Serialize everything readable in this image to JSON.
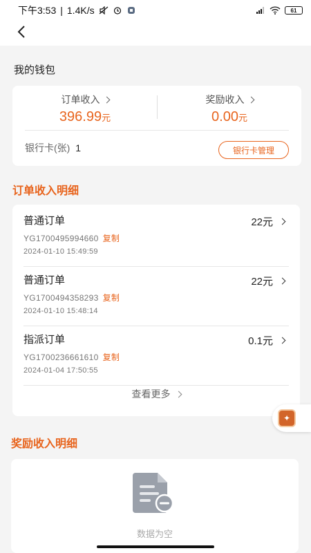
{
  "status_bar": {
    "time": "下午3:53",
    "net_speed": "1.4K/s",
    "battery": "61"
  },
  "wallet": {
    "title": "我的钱包",
    "order_income": {
      "label": "订单收入",
      "value": "396.99",
      "unit": "元"
    },
    "reward_income": {
      "label": "奖励收入",
      "value": "0.00",
      "unit": "元"
    },
    "bank_card_label": "银行卡(张)",
    "bank_card_count": "1",
    "bank_card_button": "银行卡管理"
  },
  "order_section": {
    "title": "订单收入明细",
    "copy_label": "复制",
    "orders": [
      {
        "type": "普通订单",
        "amount": "22元",
        "order_no": "YG1700495994660",
        "time": "2024-01-10 15:49:59"
      },
      {
        "type": "普通订单",
        "amount": "22元",
        "order_no": "YG1700494358293",
        "time": "2024-01-10 15:48:14"
      },
      {
        "type": "指派订单",
        "amount": "0.1元",
        "order_no": "YG1700236661610",
        "time": "2024-01-04 17:50:55"
      }
    ],
    "more_label": "查看更多"
  },
  "reward_section": {
    "title": "奖励收入明细",
    "empty_text": "数据为空"
  },
  "colors": {
    "accent": "#e8641d",
    "background": "#f4f4f4"
  }
}
